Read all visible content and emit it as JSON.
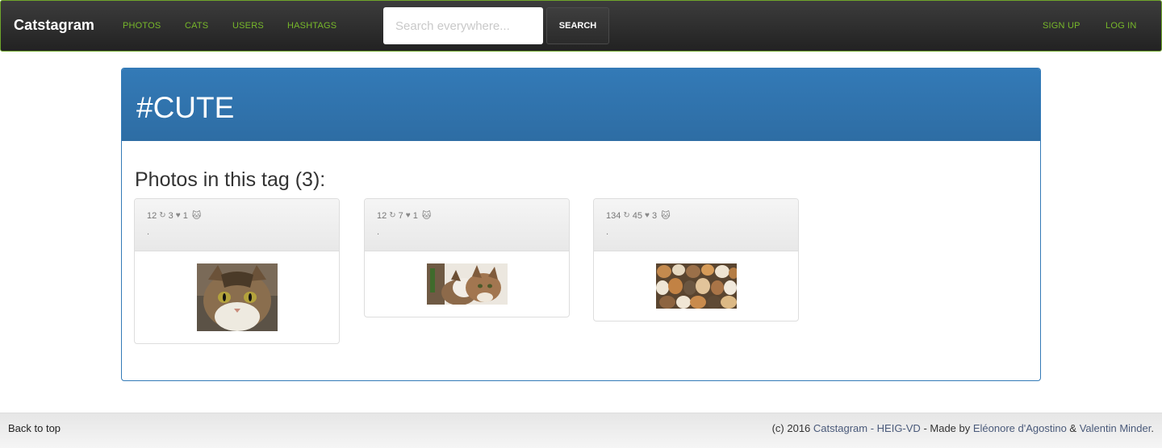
{
  "navbar": {
    "brand": "Catstagram",
    "links": [
      "PHOTOS",
      "CATS",
      "USERS",
      "HASHTAGS"
    ],
    "search_placeholder": "Search everywhere...",
    "search_button": "SEARCH",
    "auth_links": [
      "SIGN UP",
      "LOG IN"
    ],
    "accent_color": "#77b82a"
  },
  "panel": {
    "title": "#CUTE",
    "section_title": "Photos in this tag (3):",
    "header_color": "#337ab7"
  },
  "photos": [
    {
      "views": "12",
      "reposts": "3",
      "likes": "1",
      "caption": ".",
      "image": "tabby-cat-closeup"
    },
    {
      "views": "12",
      "reposts": "7",
      "likes": "1",
      "caption": ".",
      "image": "two-cats-cuddling"
    },
    {
      "views": "134",
      "reposts": "45",
      "likes": "3",
      "caption": ".",
      "image": "crowd-of-cats"
    }
  ],
  "footer": {
    "back_to_top": "Back to top",
    "credit_prefix": "(c) 2016 ",
    "credit_site": "Catstagram - HEIG-VD",
    "credit_middle": " - Made by ",
    "author1": "Eléonore d'Agostino",
    "credit_and": " & ",
    "author2": "Valentin Minder",
    "credit_end": "."
  }
}
